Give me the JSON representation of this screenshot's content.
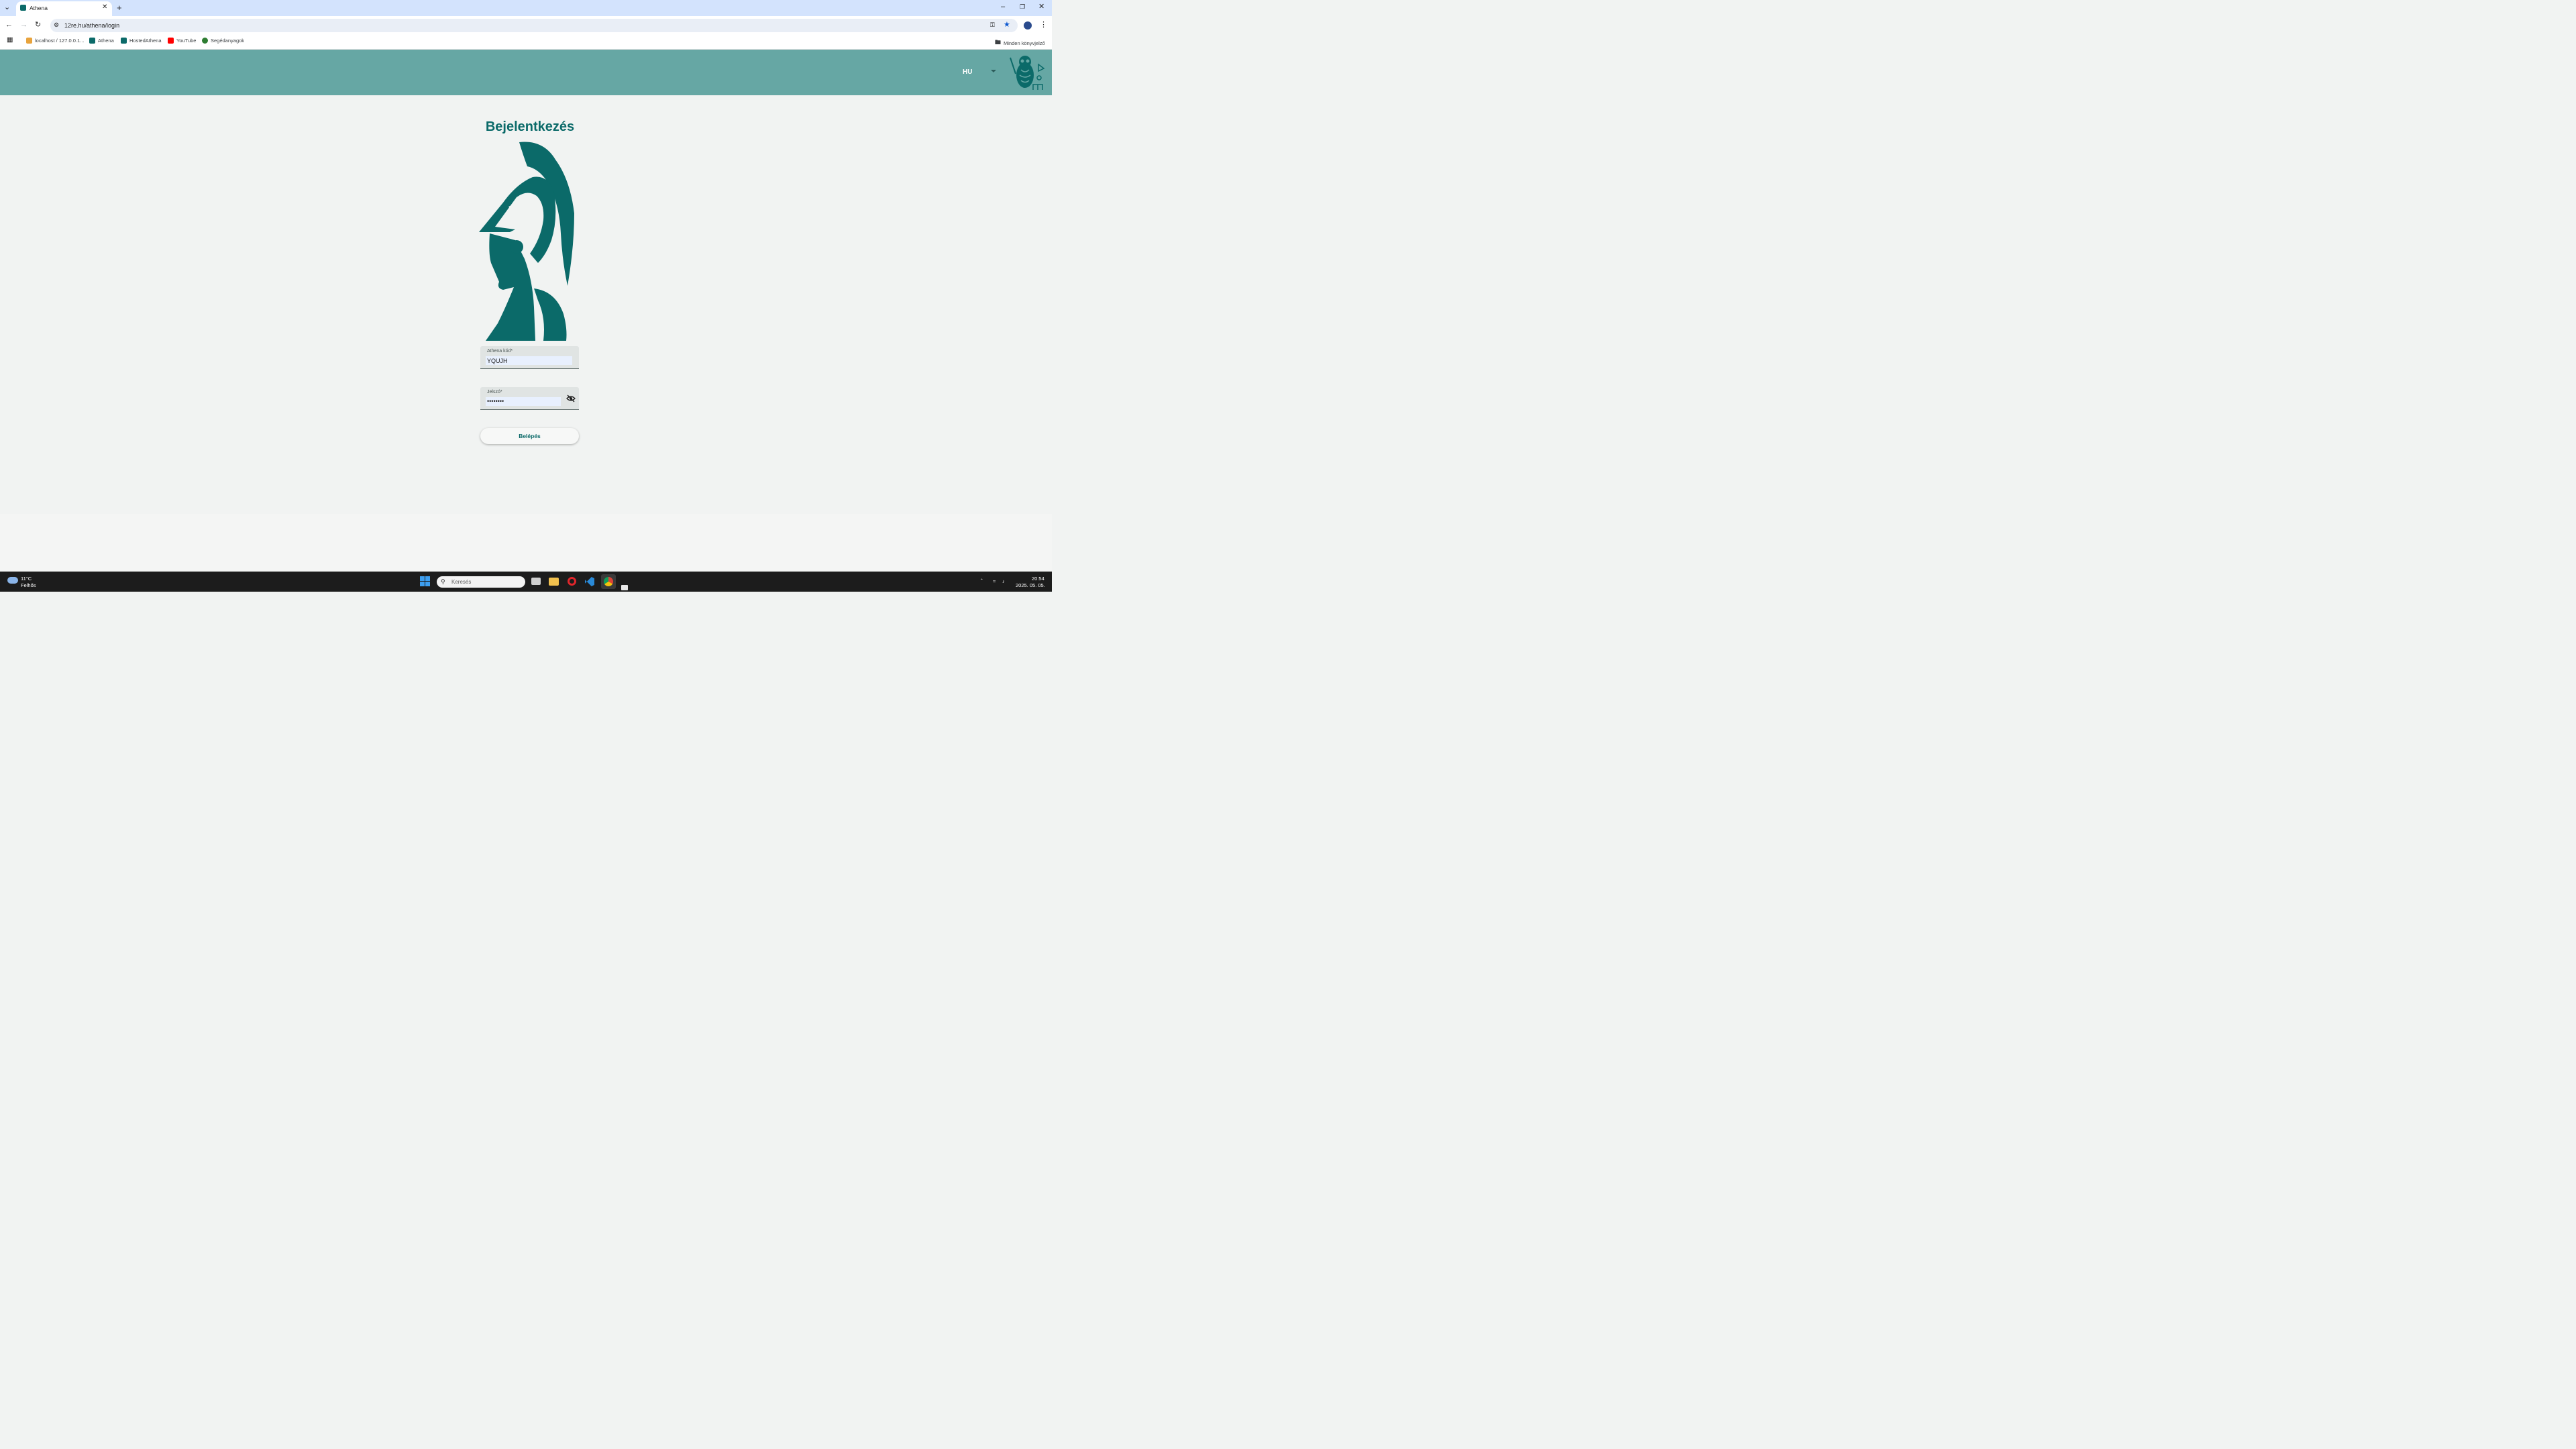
{
  "browser": {
    "tab_title": "Athena",
    "url": "12re.hu/athena/login",
    "bookmarks": [
      "localhost / 127.0.0.1...",
      "Athena",
      "HostedAthena",
      "YouTube",
      "Segédanyagok"
    ],
    "all_bookmarks": "Minden könyvjelző"
  },
  "header": {
    "language": "HU"
  },
  "login": {
    "title": "Bejelentkezés",
    "code_label": "Athena kód*",
    "code_value": "YQUJH",
    "password_label": "Jelszó*",
    "password_value": "••••••••",
    "submit_label": "Belépés"
  },
  "taskbar": {
    "weather_temp": "11°C",
    "weather_desc": "Felhős",
    "search_placeholder": "Keresés",
    "time": "20:54",
    "date": "2025. 05. 05."
  },
  "colors": {
    "brand": "#0b6a69",
    "header": "#66a7a4"
  }
}
